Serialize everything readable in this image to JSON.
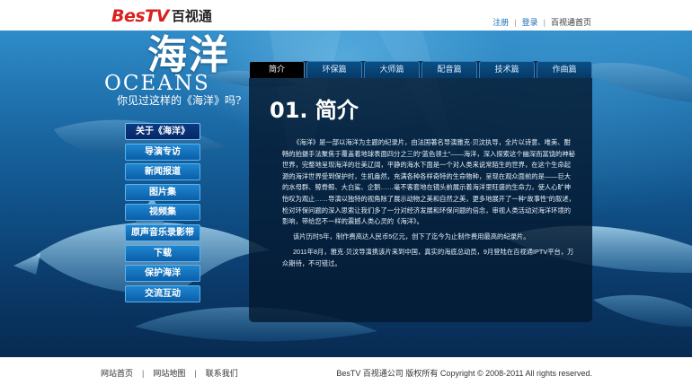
{
  "header": {
    "logo_mark": "BesTV",
    "logo_text": "百视通",
    "links": {
      "register": "注册",
      "login": "登录",
      "home": "百视通首页"
    },
    "separator": "|"
  },
  "hero": {
    "title_cn": "海洋",
    "title_en": "OCEANS",
    "tagline": "你见过这样的《海洋》吗?"
  },
  "menu": {
    "items": [
      {
        "label": "关于《海洋》"
      },
      {
        "label": "导演专访"
      },
      {
        "label": "新闻报道"
      },
      {
        "label": "图片集"
      },
      {
        "label": "视频集"
      },
      {
        "label": "原声音乐录影带"
      },
      {
        "label": "下载"
      },
      {
        "label": "保护海洋"
      },
      {
        "label": "交流互动"
      }
    ]
  },
  "tabs": [
    {
      "label": "简介"
    },
    {
      "label": "环保篇"
    },
    {
      "label": "大师篇"
    },
    {
      "label": "配音篇"
    },
    {
      "label": "技术篇"
    },
    {
      "label": "作曲篇"
    }
  ],
  "content": {
    "title": "01. 简介",
    "paragraphs": [
      "《海洋》是一部以海洋为主题的纪录片，由法国著名导演雅克·贝汶执导，全片以诗意、唯美、酣畅的拍摄手法聚焦于覆盖着地球表面四分之三的“蓝色领土”——海洋，深入探索这个幽深而富饶的神秘世界，完整地呈现海洋的壮美辽阔，平静的海水下面是一个对人类来说常陌生的世界，在这个生命起源的海洋世界受到保护时，生机盎然，充满各种各样奇特的生命物种，呈现在观众面前的是——巨大的水母群、鲸脊鲸、大白鲨、企鹅……毫不客套地在镜头前展示着海洋里旺盛的生命力，使人心旷神怡叹为观止……导演以独特的视角除了展示动物之美和自然之美，更多地展开了一种“故事性”的叙述，检对环保问题的深入思索让我们多了一分对经济发展和环保问题的倍念，审视人类活动对海洋环境的影响，带给您不一样的震撼人类心灵的《海洋》。",
      "该片历时5年，制作费高达人民币5亿元，创下了迄今为止制作费用最高的纪录片。",
      "2011年8月，雅克·贝汶导演携该片来到中国，真实的海底总动员，9月登陆在百视通IPTV平台，万众期待，不可错过。"
    ]
  },
  "footer": {
    "links": [
      "网站首页",
      "网站地图",
      "联系我们"
    ],
    "separator": "|",
    "copyright": "BesTV 百视通公司 版权所有 Copyright © 2008-2011 All rights reserved."
  },
  "colors": {
    "brand_red": "#d9221f",
    "ocean_dark": "#072b52",
    "menu_blue": "#0b5ea8",
    "link_blue": "#1b6fb5"
  }
}
